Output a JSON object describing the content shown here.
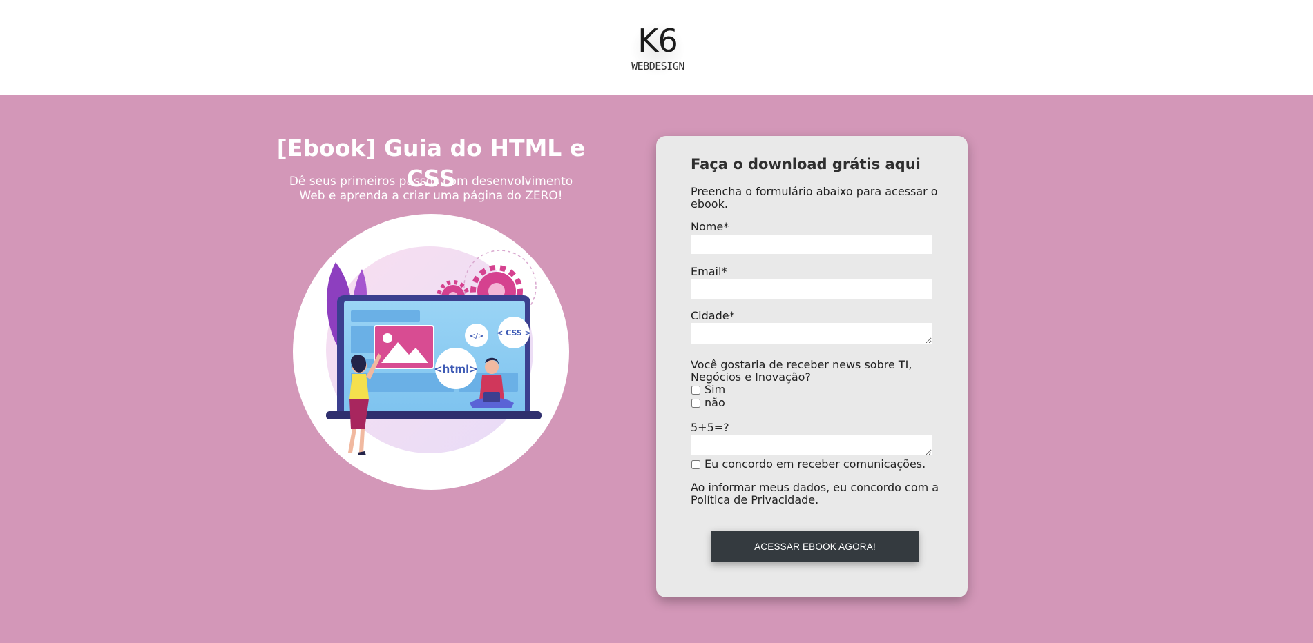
{
  "brand": {
    "logo_mark": "K6",
    "logo_sub": "WEBDESIGN"
  },
  "hero": {
    "title": "[Ebook] Guia do HTML e CSS",
    "subtitle_line1": "Dê seus primeiros passos com desenvolvimento",
    "subtitle_line2": "Web e aprenda a criar uma página do ZERO!",
    "illustration": {
      "html_tag": "<html>",
      "css_tag": "< CSS >",
      "code_tag": "</>"
    }
  },
  "form": {
    "title": "Faça o download grátis aqui",
    "description": "Preencha o formulário abaixo para acessar o ebook.",
    "name_label": "Nome*",
    "name_value": "",
    "email_label": "Email*",
    "email_value": "",
    "city_label": "Cidade*",
    "city_value": "",
    "news_question": "Você gostaria de receber news sobre TI, Negócios e Inovação?",
    "news_options": [
      {
        "label": "Sim",
        "checked": false
      },
      {
        "label": "não",
        "checked": false
      }
    ],
    "captcha_label": "5+5=?",
    "captcha_value": "",
    "consent_label": "Eu concordo em receber comunicações.",
    "consent_checked": false,
    "privacy_text": "Ao informar meus dados, eu concordo com a Política de Privacidade.",
    "submit_label": "ACESSAR EBOOK AGORA!"
  },
  "colors": {
    "page_background": "#d397b8",
    "card_background": "#e9e9e9",
    "button_background": "#343a3f"
  }
}
